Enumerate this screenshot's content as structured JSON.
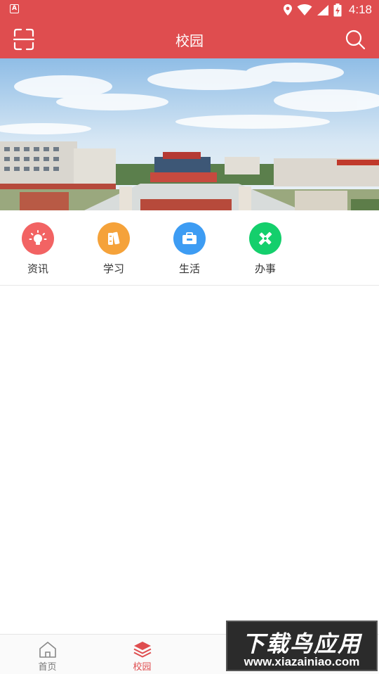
{
  "status_bar": {
    "time": "4:18",
    "notification_icon": "app-a-icon",
    "icons": [
      "location-icon",
      "wifi-icon",
      "signal-icon",
      "battery-charging-icon"
    ]
  },
  "app_bar": {
    "title": "校园",
    "left_icon": "scan-icon",
    "right_icon": "search-icon"
  },
  "banner": {
    "image": "campus-panorama-photo"
  },
  "quick_menu": {
    "items": [
      {
        "label": "资讯",
        "icon": "lightbulb-icon",
        "color": "#f26363"
      },
      {
        "label": "学习",
        "icon": "books-icon",
        "color": "#f5a23a"
      },
      {
        "label": "生活",
        "icon": "briefcase-icon",
        "color": "#3d9cf3"
      },
      {
        "label": "办事",
        "icon": "pencil-ruler-icon",
        "color": "#14cf6c"
      }
    ]
  },
  "tab_bar": {
    "items": [
      {
        "label": "首页",
        "icon": "home-icon",
        "active": false
      },
      {
        "label": "校园",
        "icon": "layers-icon",
        "active": true
      }
    ]
  },
  "watermark": {
    "title": "下载鸟应用",
    "url": "www.xiazainiao.com"
  },
  "colors": {
    "primary": "#df4d4f",
    "tab_inactive": "#777777"
  }
}
